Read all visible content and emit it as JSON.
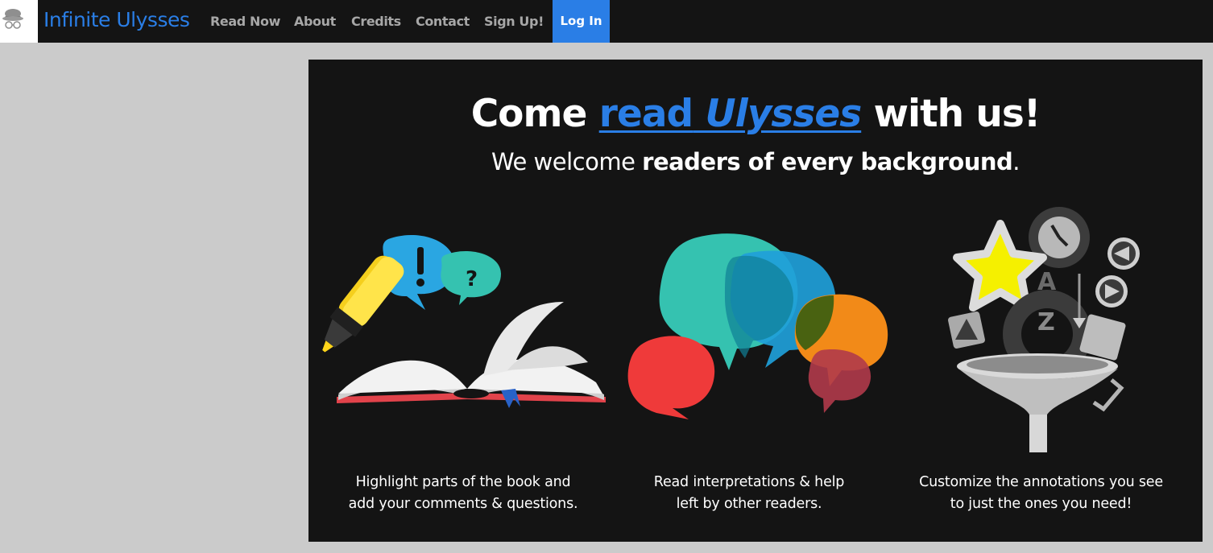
{
  "nav": {
    "brand": "Infinite Ulysses",
    "items": [
      "Read Now",
      "About",
      "Credits",
      "Contact",
      "Sign Up!"
    ],
    "login": "Log In"
  },
  "hero": {
    "headline_pre": "Come",
    "headline_link_word": "read",
    "headline_link_title": "Ulysses",
    "headline_post": "with us!",
    "sub_pre": "We welcome",
    "sub_bold": "readers of every background",
    "sub_post": "."
  },
  "features": [
    {
      "icon": "highlighter-book-icon",
      "line1": "Highlight parts of the book and",
      "line2": "add your comments & questions."
    },
    {
      "icon": "speech-bubbles-icon",
      "line1": "Read interpretations & help",
      "line2": "left by other readers."
    },
    {
      "icon": "filter-funnel-icon",
      "line1": "Customize the annotations you see",
      "line2": "to just the ones you need!"
    }
  ],
  "colors": {
    "accent": "#2a7ee6",
    "navbar": "#141414",
    "panel": "#141414",
    "page_bg": "#cbcbcb"
  }
}
